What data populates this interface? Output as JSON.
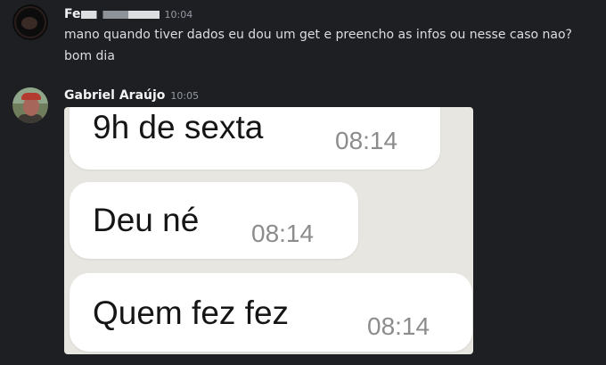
{
  "messages": [
    {
      "author": "Fe",
      "time": "10:04",
      "lines": [
        "mano quando tiver dados eu dou um get e preencho as infos ou nesse caso nao?",
        "bom dia"
      ]
    },
    {
      "author": "Gabriel Araújo",
      "time": "10:05",
      "image_bubbles": [
        {
          "text": "9h de sexta",
          "time": "08:14"
        },
        {
          "text": "Deu né",
          "time": "08:14"
        },
        {
          "text": "Quem fez fez",
          "time": "08:14"
        }
      ]
    }
  ],
  "colors": {
    "background": "#1e1f22",
    "username": "#f2f3f5",
    "text": "#dbdee1",
    "timestamp": "#949ba4"
  }
}
